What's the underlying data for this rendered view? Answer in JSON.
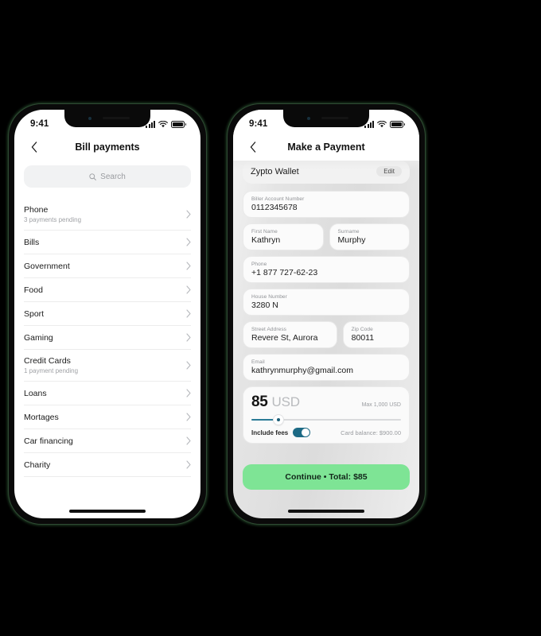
{
  "theme": {
    "accent_green": "#7ee495",
    "toggle_teal": "#1d6a85",
    "slider_teal": "#2b7b96",
    "frame_outline_green": "#2f4a33",
    "text_primary": "#1a1a1a",
    "text_muted": "#9a9ca0"
  },
  "phone1": {
    "status": {
      "time": "9:41",
      "signal_icon": "cellular-bars-icon",
      "wifi_icon": "wifi-icon",
      "battery_icon": "battery-icon"
    },
    "nav": {
      "back_icon": "chevron-left-icon",
      "title": "Bill payments"
    },
    "search": {
      "icon": "search-icon",
      "placeholder": "Search",
      "value": ""
    },
    "list": [
      {
        "title": "Phone",
        "sub": "3 payments pending"
      },
      {
        "title": "Bills",
        "sub": ""
      },
      {
        "title": "Government",
        "sub": ""
      },
      {
        "title": "Food",
        "sub": ""
      },
      {
        "title": "Sport",
        "sub": ""
      },
      {
        "title": "Gaming",
        "sub": ""
      },
      {
        "title": "Credit Cards",
        "sub": "1 payment pending"
      },
      {
        "title": "Loans",
        "sub": ""
      },
      {
        "title": "Mortages",
        "sub": ""
      },
      {
        "title": "Car financing",
        "sub": ""
      },
      {
        "title": "Charity",
        "sub": ""
      }
    ]
  },
  "phone2": {
    "status": {
      "time": "9:41",
      "signal_icon": "cellular-bars-icon",
      "wifi_icon": "wifi-icon",
      "battery_icon": "battery-icon"
    },
    "nav": {
      "back_icon": "chevron-left-icon",
      "title": "Make a Payment"
    },
    "wallet": {
      "name": "Zypto Wallet",
      "edit_label": "Edit"
    },
    "fields": {
      "biller": {
        "label": "Biller Account Number",
        "value": "0112345678"
      },
      "first_name": {
        "label": "First Name",
        "value": "Kathryn"
      },
      "surname": {
        "label": "Surname",
        "value": "Murphy"
      },
      "phone": {
        "label": "Phone",
        "value": "+1 877 727-62-23"
      },
      "house_number": {
        "label": "House Number",
        "value": "3280 N"
      },
      "street": {
        "label": "Street Address",
        "value": "Revere St, Aurora"
      },
      "zip": {
        "label": "Zip Code",
        "value": "80011"
      },
      "email": {
        "label": "Email",
        "value": "kathrynmurphy@gmail.com"
      }
    },
    "amount": {
      "value": "85",
      "currency": "USD",
      "max_label": "Max 1,000 USD",
      "slider_percent": 18,
      "include_fees_label": "Include fees",
      "include_fees_on": true,
      "balance_label": "Card balance: $900.00"
    },
    "cta": {
      "label": "Continue • Total: $85"
    }
  }
}
